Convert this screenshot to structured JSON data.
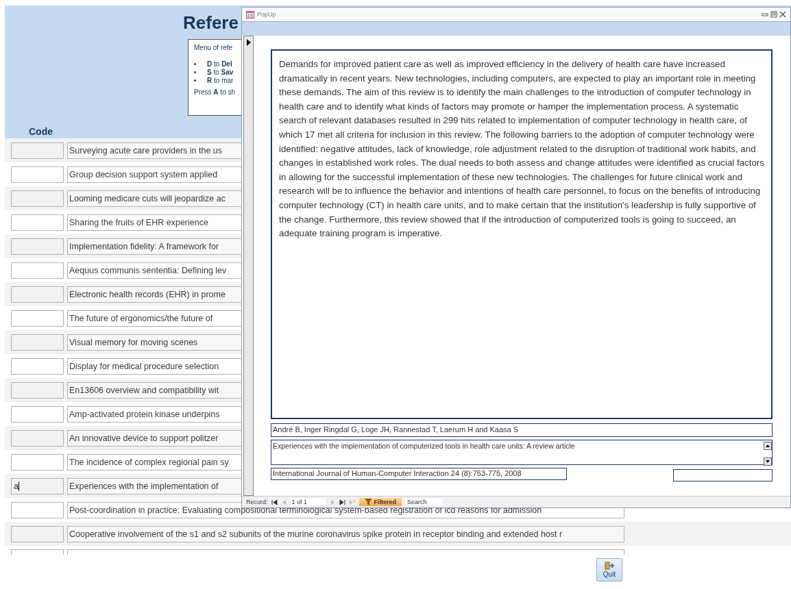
{
  "form": {
    "title": "Refere",
    "menu": {
      "heading": "Menu of refe",
      "items": [
        "**D** to **Del**",
        "**S** to **Sav**",
        "**R** to mar"
      ],
      "footer": "Press **A** to sh"
    },
    "columns": [
      "Code"
    ],
    "rows": [
      {
        "title": "Surveying acute care providers in the us"
      },
      {
        "title": "Group decision support system applied"
      },
      {
        "title": "Looming medicare cuts will jeopardize ac"
      },
      {
        "title": "Sharing the fruits of EHR experience"
      },
      {
        "title": "Implementation fidelity: A framework for"
      },
      {
        "title": "Aequus communis sententia: Defining lev"
      },
      {
        "title": "Electronic health records (EHR) in prome"
      },
      {
        "title": "The future of ergonomics/the future of"
      },
      {
        "title": "Visual memory for moving scenes"
      },
      {
        "title": "Display for medical procedure selection"
      },
      {
        "title": "En13606 overview and compatibility wit"
      },
      {
        "title": "Amp-activated protein kinase underpins"
      },
      {
        "title": "An innovative device to support politzer"
      },
      {
        "title": "The incidence of complex regional pain sy"
      },
      {
        "code": "a",
        "title": "Experiences with the implementation of"
      },
      {
        "title": "Post-coordination in practice: Evaluating compositional terminological system-based registration of icd reasons for admission"
      },
      {
        "title": "Cooperative involvement of the s1 and s2 subunits of the murine coronavirus spike protein in receptor binding and extended host r"
      }
    ],
    "quit": {
      "label": "Quit"
    }
  },
  "popup": {
    "title": "PopUp",
    "abstract": "Demands for improved patient care as well as improved efficiency in the delivery of health care have increased dramatically in recent years. New technologies, including computers, are expected to play an important role in meeting these demands. The aim of this review is to identify the main challenges to the introduction of computer technology in health care and to identify what kinds of factors may promote or hamper the implementation process. A systematic search of relevant databases resulted in 299 hits related to implementation of computer technology in health care, of which 17 met all criteria for inclusion in this review. The following barriers to the adoption of computer technology were identified: negative attitudes, lack of knowledge, role adjustment related to the disruption of traditional work habits, and changes in established work roles. The dual needs to both assess and change attitudes were identified as crucial factors in allowing for the successful implementation of these new technologies. The challenges for future clinical work and research will be to influence the behavior and intentions of health care personnel, to focus on the benefits of introducing computer technology (CT) in health care units, and to make certain that the institution's leadership is fully supportive of the change. Furthermore, this review showed that if the introduction of computerized tools is going to succeed, an adequate training program is imperative.",
    "authors": "André B, Inger Ringdal G, Loge JH, Rannestad T, Laerum H and Kaasa S",
    "article_title": "Experiences with the implementation of computerized tools in health care units: A review article",
    "journal": "International Journal of Human-Computer Interaction 24 (8):753-775, 2008",
    "navigator": {
      "label": "Record:",
      "position": "1 of 1",
      "filter": "Filtered",
      "search": "Search"
    }
  }
}
